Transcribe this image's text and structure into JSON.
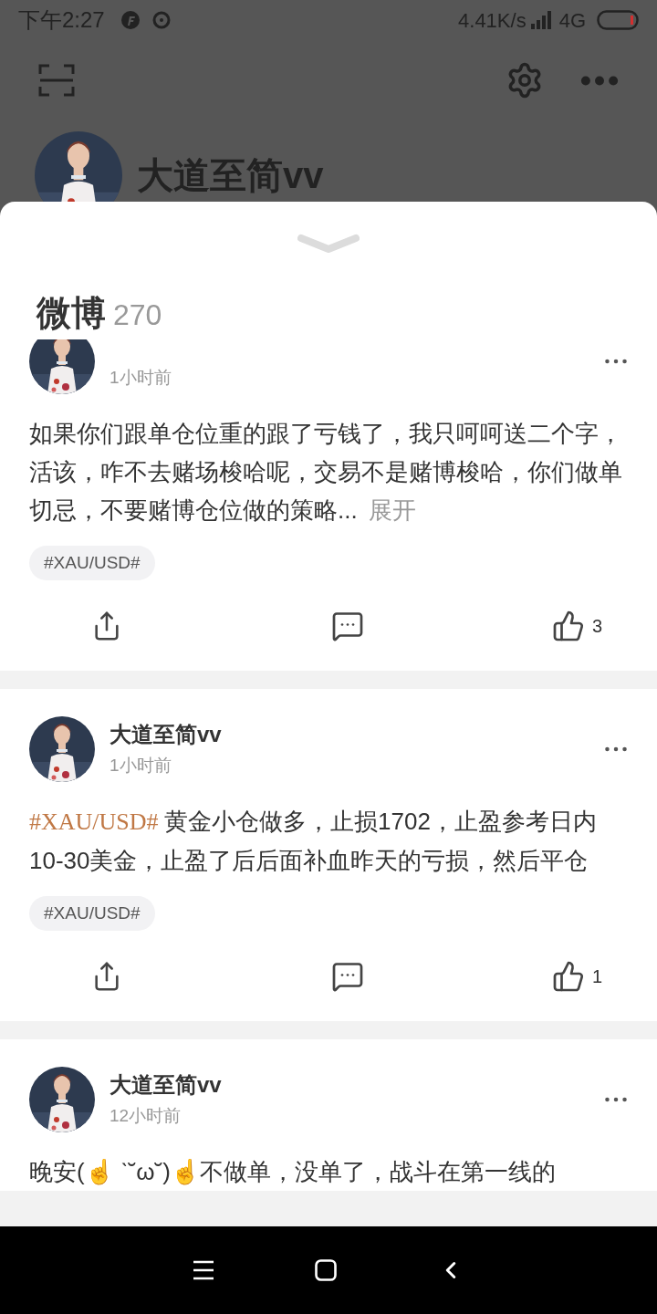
{
  "status_bar": {
    "time": "下午2:27",
    "speed": "4.41K/s",
    "network": "4G"
  },
  "profile": {
    "name": "大道至简vv"
  },
  "sheet": {
    "title": "微博",
    "count": "270"
  },
  "posts": [
    {
      "time": "1小时前",
      "text": "如果你们跟单仓位重的跟了亏钱了，我只呵呵送二个字，活该，咋不去赌场梭哈呢，交易不是赌博梭哈，你们做单切忌，不要赌博仓位做的策略...",
      "expand": "展开",
      "tag": "#XAU/USD#",
      "likes": "3"
    },
    {
      "author": "大道至简vv",
      "time": "1小时前",
      "topic": "#XAU/USD#",
      "text": "黄金小仓做多，止损1702，止盈参考日内10-30美金，止盈了后后面补血昨天的亏损，然后平仓",
      "tag": "#XAU/USD#",
      "likes": "1"
    },
    {
      "author": "大道至简vv",
      "time": "12小时前",
      "text": "晚安(☝ ˋ˘ω˘)☝不做单，没单了，战斗在第一线的"
    }
  ]
}
